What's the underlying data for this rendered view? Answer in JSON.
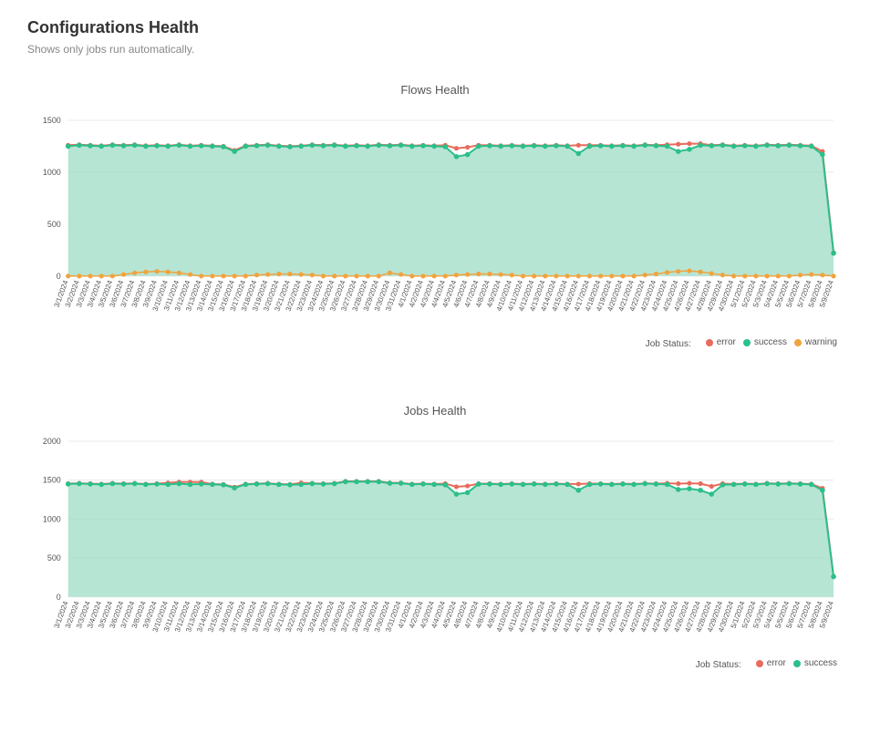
{
  "header": {
    "title": "Configurations Health",
    "subtitle": "Shows only jobs run automatically."
  },
  "colors": {
    "success": "#2bbf8a",
    "success_fill": "#9fdcc4",
    "error": "#e86b5c",
    "warning": "#f0a33e",
    "axis": "#aaaaaa",
    "grid": "#e8e8e8",
    "text": "#555555"
  },
  "chart_data": [
    {
      "type": "area",
      "title": "Flows Health",
      "ylim": [
        0,
        1500
      ],
      "yticks": [
        0,
        500,
        1000,
        1500
      ],
      "legend_title": "Job Status:",
      "legend": [
        {
          "name": "error",
          "color_key": "error"
        },
        {
          "name": "success",
          "color_key": "success"
        },
        {
          "name": "warning",
          "color_key": "warning"
        }
      ],
      "categories": [
        "3/1/2024",
        "3/2/2024",
        "3/3/2024",
        "3/4/2024",
        "3/5/2024",
        "3/6/2024",
        "3/7/2024",
        "3/8/2024",
        "3/9/2024",
        "3/10/2024",
        "3/11/2024",
        "3/12/2024",
        "3/13/2024",
        "3/14/2024",
        "3/15/2024",
        "3/16/2024",
        "3/17/2024",
        "3/18/2024",
        "3/19/2024",
        "3/20/2024",
        "3/21/2024",
        "3/22/2024",
        "3/23/2024",
        "3/24/2024",
        "3/25/2024",
        "3/26/2024",
        "3/27/2024",
        "3/28/2024",
        "3/29/2024",
        "3/30/2024",
        "3/31/2024",
        "4/1/2024",
        "4/2/2024",
        "4/3/2024",
        "4/4/2024",
        "4/5/2024",
        "4/6/2024",
        "4/7/2024",
        "4/8/2024",
        "4/9/2024",
        "4/10/2024",
        "4/11/2024",
        "4/12/2024",
        "4/13/2024",
        "4/14/2024",
        "4/15/2024",
        "4/16/2024",
        "4/17/2024",
        "4/18/2024",
        "4/19/2024",
        "4/20/2024",
        "4/21/2024",
        "4/22/2024",
        "4/23/2024",
        "4/24/2024",
        "4/25/2024",
        "4/26/2024",
        "4/27/2024",
        "4/28/2024",
        "4/29/2024",
        "4/30/2024",
        "5/1/2024",
        "5/2/2024",
        "5/3/2024",
        "5/4/2024",
        "5/5/2024",
        "5/6/2024",
        "5/7/2024",
        "5/8/2024",
        "5/9/2024"
      ],
      "series": [
        {
          "name": "success",
          "color_key": "success",
          "fill_key": "success_fill",
          "values": [
            1250,
            1260,
            1255,
            1250,
            1260,
            1255,
            1260,
            1250,
            1255,
            1250,
            1260,
            1250,
            1255,
            1250,
            1245,
            1200,
            1250,
            1255,
            1260,
            1250,
            1245,
            1250,
            1260,
            1255,
            1260,
            1250,
            1255,
            1250,
            1260,
            1255,
            1260,
            1250,
            1255,
            1250,
            1245,
            1150,
            1170,
            1250,
            1255,
            1250,
            1255,
            1250,
            1255,
            1250,
            1255,
            1250,
            1180,
            1250,
            1255,
            1250,
            1255,
            1250,
            1260,
            1255,
            1250,
            1200,
            1220,
            1260,
            1255,
            1260,
            1250,
            1255,
            1250,
            1260,
            1255,
            1260,
            1255,
            1250,
            1170,
            220
          ]
        },
        {
          "name": "error",
          "color_key": "error",
          "values": [
            1260,
            1265,
            1260,
            1255,
            1265,
            1260,
            1265,
            1255,
            1260,
            1255,
            1265,
            1255,
            1260,
            1255,
            1250,
            1210,
            1255,
            1260,
            1265,
            1255,
            1250,
            1255,
            1265,
            1260,
            1265,
            1255,
            1260,
            1255,
            1265,
            1260,
            1265,
            1255,
            1260,
            1255,
            1260,
            1230,
            1240,
            1260,
            1260,
            1255,
            1260,
            1255,
            1260,
            1255,
            1260,
            1255,
            1260,
            1260,
            1260,
            1255,
            1260,
            1255,
            1265,
            1260,
            1265,
            1270,
            1275,
            1275,
            1260,
            1265,
            1255,
            1260,
            1255,
            1265,
            1260,
            1265,
            1260,
            1255,
            1200,
            225
          ]
        },
        {
          "name": "warning",
          "color_key": "warning",
          "values": [
            0,
            0,
            0,
            0,
            0,
            15,
            30,
            40,
            45,
            40,
            30,
            15,
            0,
            0,
            0,
            0,
            0,
            10,
            15,
            20,
            20,
            15,
            10,
            0,
            0,
            0,
            0,
            0,
            0,
            30,
            15,
            0,
            0,
            0,
            0,
            10,
            15,
            20,
            20,
            15,
            10,
            0,
            0,
            0,
            0,
            0,
            0,
            0,
            0,
            0,
            0,
            0,
            10,
            20,
            35,
            45,
            50,
            40,
            25,
            10,
            0,
            0,
            0,
            0,
            0,
            0,
            10,
            15,
            10,
            0
          ]
        }
      ]
    },
    {
      "type": "area",
      "title": "Jobs Health",
      "ylim": [
        0,
        2000
      ],
      "yticks": [
        0,
        500,
        1000,
        1500,
        2000
      ],
      "legend_title": "Job Status:",
      "legend": [
        {
          "name": "error",
          "color_key": "error"
        },
        {
          "name": "success",
          "color_key": "success"
        }
      ],
      "categories": [
        "3/1/2024",
        "3/2/2024",
        "3/3/2024",
        "3/4/2024",
        "3/5/2024",
        "3/6/2024",
        "3/7/2024",
        "3/8/2024",
        "3/9/2024",
        "3/10/2024",
        "3/11/2024",
        "3/12/2024",
        "3/13/2024",
        "3/14/2024",
        "3/15/2024",
        "3/16/2024",
        "3/17/2024",
        "3/18/2024",
        "3/19/2024",
        "3/20/2024",
        "3/21/2024",
        "3/22/2024",
        "3/23/2024",
        "3/24/2024",
        "3/25/2024",
        "3/26/2024",
        "3/27/2024",
        "3/28/2024",
        "3/29/2024",
        "3/30/2024",
        "3/31/2024",
        "4/1/2024",
        "4/2/2024",
        "4/3/2024",
        "4/4/2024",
        "4/5/2024",
        "4/6/2024",
        "4/7/2024",
        "4/8/2024",
        "4/9/2024",
        "4/10/2024",
        "4/11/2024",
        "4/12/2024",
        "4/13/2024",
        "4/14/2024",
        "4/15/2024",
        "4/16/2024",
        "4/17/2024",
        "4/18/2024",
        "4/19/2024",
        "4/20/2024",
        "4/21/2024",
        "4/22/2024",
        "4/23/2024",
        "4/24/2024",
        "4/25/2024",
        "4/26/2024",
        "4/27/2024",
        "4/28/2024",
        "4/29/2024",
        "4/30/2024",
        "5/1/2024",
        "5/2/2024",
        "5/3/2024",
        "5/4/2024",
        "5/5/2024",
        "5/6/2024",
        "5/7/2024",
        "5/8/2024",
        "5/9/2024"
      ],
      "series": [
        {
          "name": "success",
          "color_key": "success",
          "fill_key": "success_fill",
          "values": [
            1450,
            1455,
            1450,
            1445,
            1455,
            1450,
            1455,
            1445,
            1450,
            1445,
            1455,
            1445,
            1450,
            1445,
            1440,
            1400,
            1445,
            1450,
            1455,
            1445,
            1440,
            1445,
            1455,
            1450,
            1455,
            1480,
            1480,
            1480,
            1480,
            1460,
            1460,
            1445,
            1450,
            1445,
            1440,
            1320,
            1340,
            1450,
            1450,
            1445,
            1450,
            1445,
            1450,
            1445,
            1450,
            1445,
            1370,
            1445,
            1450,
            1445,
            1450,
            1445,
            1455,
            1450,
            1445,
            1380,
            1390,
            1370,
            1320,
            1440,
            1445,
            1450,
            1445,
            1455,
            1450,
            1455,
            1450,
            1445,
            1370,
            260
          ]
        },
        {
          "name": "error",
          "color_key": "error",
          "values": [
            1455,
            1460,
            1455,
            1450,
            1460,
            1455,
            1460,
            1450,
            1455,
            1465,
            1475,
            1475,
            1475,
            1450,
            1445,
            1410,
            1450,
            1455,
            1460,
            1450,
            1445,
            1465,
            1460,
            1455,
            1460,
            1485,
            1485,
            1485,
            1485,
            1465,
            1465,
            1450,
            1455,
            1450,
            1455,
            1415,
            1425,
            1455,
            1455,
            1450,
            1455,
            1450,
            1455,
            1450,
            1455,
            1450,
            1450,
            1455,
            1455,
            1450,
            1455,
            1450,
            1460,
            1455,
            1460,
            1455,
            1460,
            1455,
            1420,
            1455,
            1450,
            1455,
            1450,
            1460,
            1455,
            1460,
            1455,
            1450,
            1395,
            265
          ]
        }
      ]
    }
  ]
}
